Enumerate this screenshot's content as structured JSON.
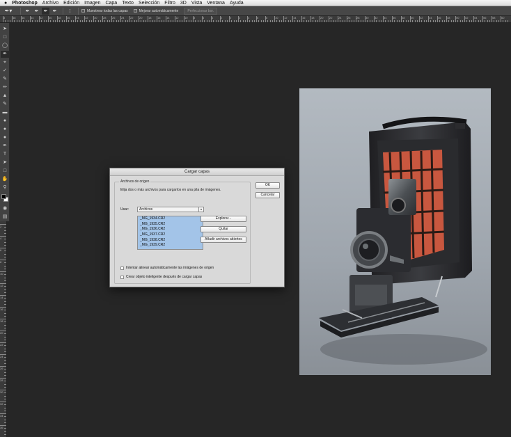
{
  "menubar": {
    "items": [
      "Photoshop",
      "Archivo",
      "Edición",
      "Imagen",
      "Capa",
      "Texto",
      "Selección",
      "Filtro",
      "3D",
      "Vista",
      "Ventana",
      "Ayuda"
    ]
  },
  "options_bar": {
    "sample_all_layers": "Muestrear todas las capas",
    "auto_enhance": "Mejorar automáticamente",
    "refine_edge": "Perfeccionar bor."
  },
  "ruler": {
    "h_labels": [
      "8",
      "48",
      "46",
      "44",
      "42",
      "40",
      "38",
      "36",
      "34",
      "32",
      "30",
      "28",
      "26",
      "24",
      "22",
      "20",
      "18",
      "16",
      "14",
      "12",
      "10",
      "8",
      "6",
      "4",
      "2",
      "0",
      "2",
      "4",
      "6",
      "8",
      "10",
      "12",
      "14",
      "16",
      "18",
      "20",
      "22",
      "24",
      "26",
      "28",
      "30",
      "32",
      "34",
      "36",
      "38",
      "40",
      "42",
      "44",
      "46",
      "48",
      "50",
      "52",
      "54",
      "56",
      "58",
      "60"
    ],
    "v_labels": [
      "2",
      "4",
      "6",
      "8",
      "10",
      "12",
      "14",
      "16",
      "18",
      "20",
      "22",
      "24",
      "26",
      "28",
      "30",
      "32",
      "34",
      "36"
    ]
  },
  "dialog": {
    "title": "Cargar capas",
    "group_title": "Archivos de origen",
    "description": "Elija dos o más archivos para cargarlos en una pila de imágenes.",
    "use_label": "Usar:",
    "use_value": "Archivos",
    "files": [
      "_MG_1934.CR2",
      "_MG_1935.CR2",
      "_MG_1936.CR2",
      "_MG_1937.CR2",
      "_MG_1938.CR2",
      "_MG_1939.CR2"
    ],
    "browse_button": "Explorar...",
    "remove_button": "Quitar",
    "add_open_button": "Añadir archivos abiertos",
    "ok_button": "OK",
    "cancel_button": "Cancelar",
    "auto_align_label": "Intentar alinear automáticamente las imágenes de origen",
    "smart_object_label": "Crear objeto inteligente después de cargar capas"
  },
  "colors": {
    "workspace": "#262626",
    "list_selection": "#a3c4e8",
    "bellows": "#c8573f"
  }
}
